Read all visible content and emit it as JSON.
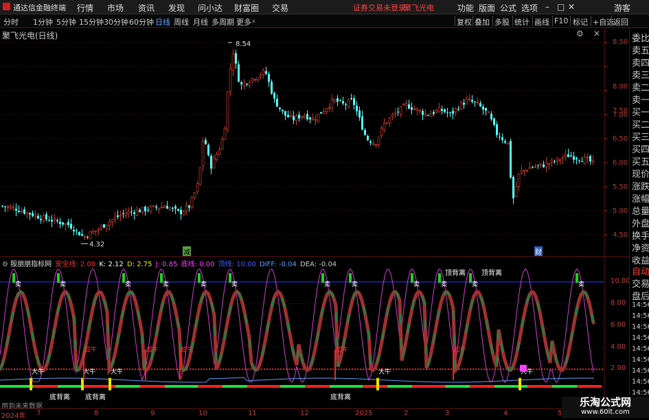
{
  "app": {
    "title": "通达信金融终端",
    "menu": [
      "行情",
      "市场",
      "资讯",
      "发现",
      "问小达",
      "财富圈",
      "交易"
    ],
    "login_status": "证券交易未登录",
    "stock_link": "聚飞光电",
    "right_menu": [
      "功能",
      "版面",
      "公式",
      "选项"
    ],
    "guest": "游客"
  },
  "toolbar": {
    "periods": [
      "分时",
      "1分钟",
      "5分钟",
      "15分钟",
      "30分钟",
      "60分钟",
      "日线",
      "周线",
      "月线",
      "多周期",
      "更多"
    ],
    "active_period": "日线",
    "tools": [
      "复权",
      "叠加",
      "多股",
      "统计",
      "画线",
      "F10",
      "标记",
      "+自选",
      "返回"
    ]
  },
  "main_chart": {
    "title": "聚飞光电(日线)",
    "high_label": "8.54",
    "low_label": "4.32",
    "y_ticks": [
      "8.50",
      "8.00",
      "7.50",
      "7.00",
      "6.50",
      "6.00",
      "5.50",
      "5.00",
      "4.50"
    ],
    "event_marks": [
      "减",
      "财"
    ]
  },
  "indicator": {
    "name": "殷朋朋指标网",
    "params": [
      {
        "label": "安全线",
        "value": "2.00",
        "color": "#ff3030"
      },
      {
        "label": "K",
        "value": "2.12",
        "color": "#ffffff"
      },
      {
        "label": "D",
        "value": "2.75",
        "color": "#f0f000"
      },
      {
        "label": "J",
        "value": "0.85",
        "color": "#ff40ff"
      },
      {
        "label": "底线",
        "value": "0.00",
        "color": "#ff40ff"
      },
      {
        "label": "顶线",
        "value": "10.00",
        "color": "#4060ff"
      },
      {
        "label": "DIFF",
        "value": "-0.04",
        "color": "#5aa0ff"
      },
      {
        "label": "DEA",
        "value": "-0.04",
        "color": "#cccccc"
      }
    ],
    "y_ticks": [
      "10.00",
      "8.00",
      "6.00",
      "4.00",
      "2.00"
    ],
    "signal_top": [
      "顶背离",
      "顶背离"
    ],
    "signal_bottom": [
      "底背离",
      "底背离",
      "底背离"
    ],
    "sell_label": "卖",
    "buy_label": "大牛",
    "hot_label": "超牛",
    "future_text": "用到未来数据"
  },
  "side_quote": [
    "委比",
    "卖五",
    "卖四",
    "卖三",
    "卖二",
    "卖一",
    "买一",
    "买二",
    "买三",
    "买四",
    "买五",
    "现价",
    "涨跌",
    "涨幅",
    "总量",
    "外盘",
    "换手",
    "净资",
    "收益"
  ],
  "side_auto": [
    "自动",
    "交易",
    "盘后"
  ],
  "side_times": [
    "14:56",
    "14:56",
    "14:56",
    "14:56",
    "14:56",
    "14:56",
    "14:56",
    "14:56",
    "14:56",
    "14:56"
  ],
  "bottom_axis": [
    "2024年",
    "7",
    "8",
    "9",
    "10",
    "11",
    "12",
    "2025",
    "2",
    "3",
    "4",
    "5"
  ],
  "watermark": {
    "title": "乐淘公式网",
    "url": "www.60lt.com"
  }
}
